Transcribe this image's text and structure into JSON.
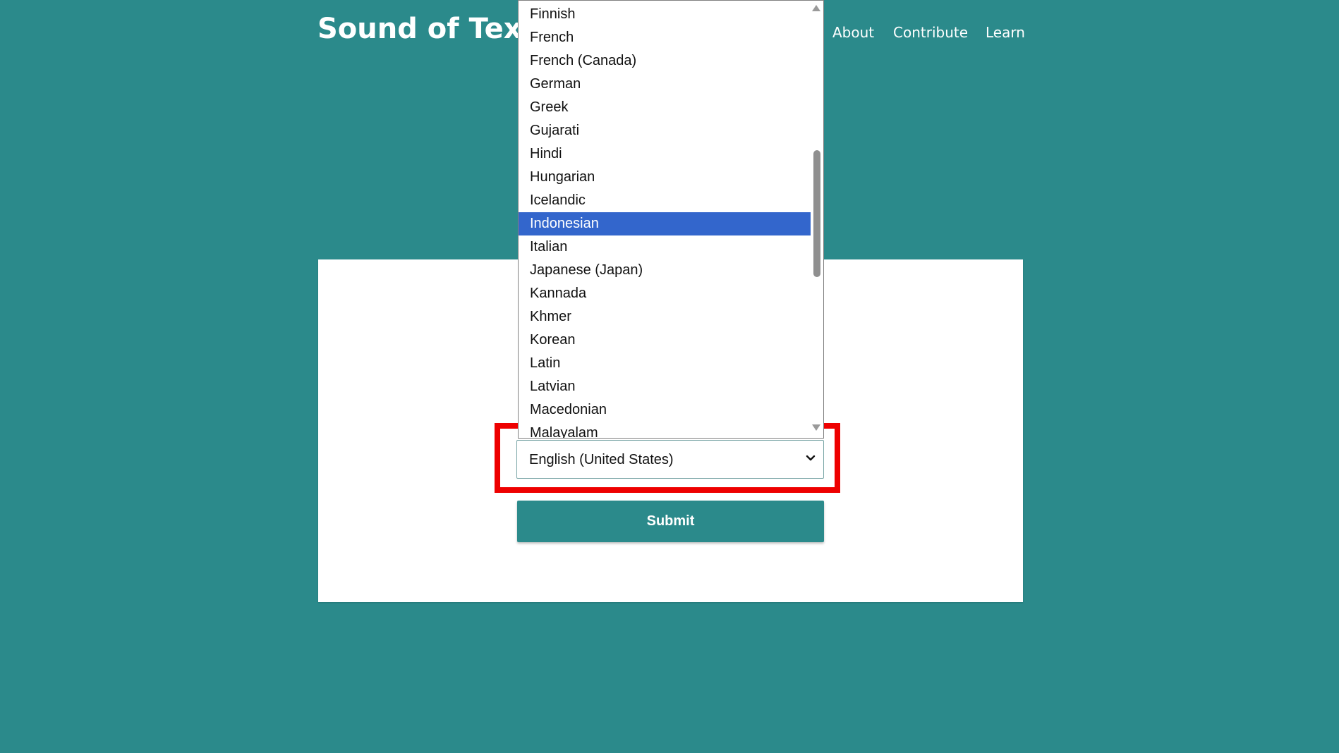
{
  "header": {
    "brand": "Sound of Text",
    "nav": [
      {
        "label": "About"
      },
      {
        "label": "Contribute"
      },
      {
        "label": "Learn"
      }
    ]
  },
  "form": {
    "language_select": {
      "selected_value": "English (United States)",
      "chevron_icon": "chevron-down-icon"
    },
    "submit_label": "Submit"
  },
  "dropdown": {
    "highlighted": "Indonesian",
    "options": [
      "Finnish",
      "French",
      "French (Canada)",
      "German",
      "Greek",
      "Gujarati",
      "Hindi",
      "Hungarian",
      "Icelandic",
      "Indonesian",
      "Italian",
      "Japanese (Japan)",
      "Kannada",
      "Khmer",
      "Korean",
      "Latin",
      "Latvian",
      "Macedonian",
      "Malayalam"
    ]
  },
  "colors": {
    "background": "#2b8a8b",
    "selected_option": "#3366cc",
    "annotation_box": "#ee0000"
  }
}
